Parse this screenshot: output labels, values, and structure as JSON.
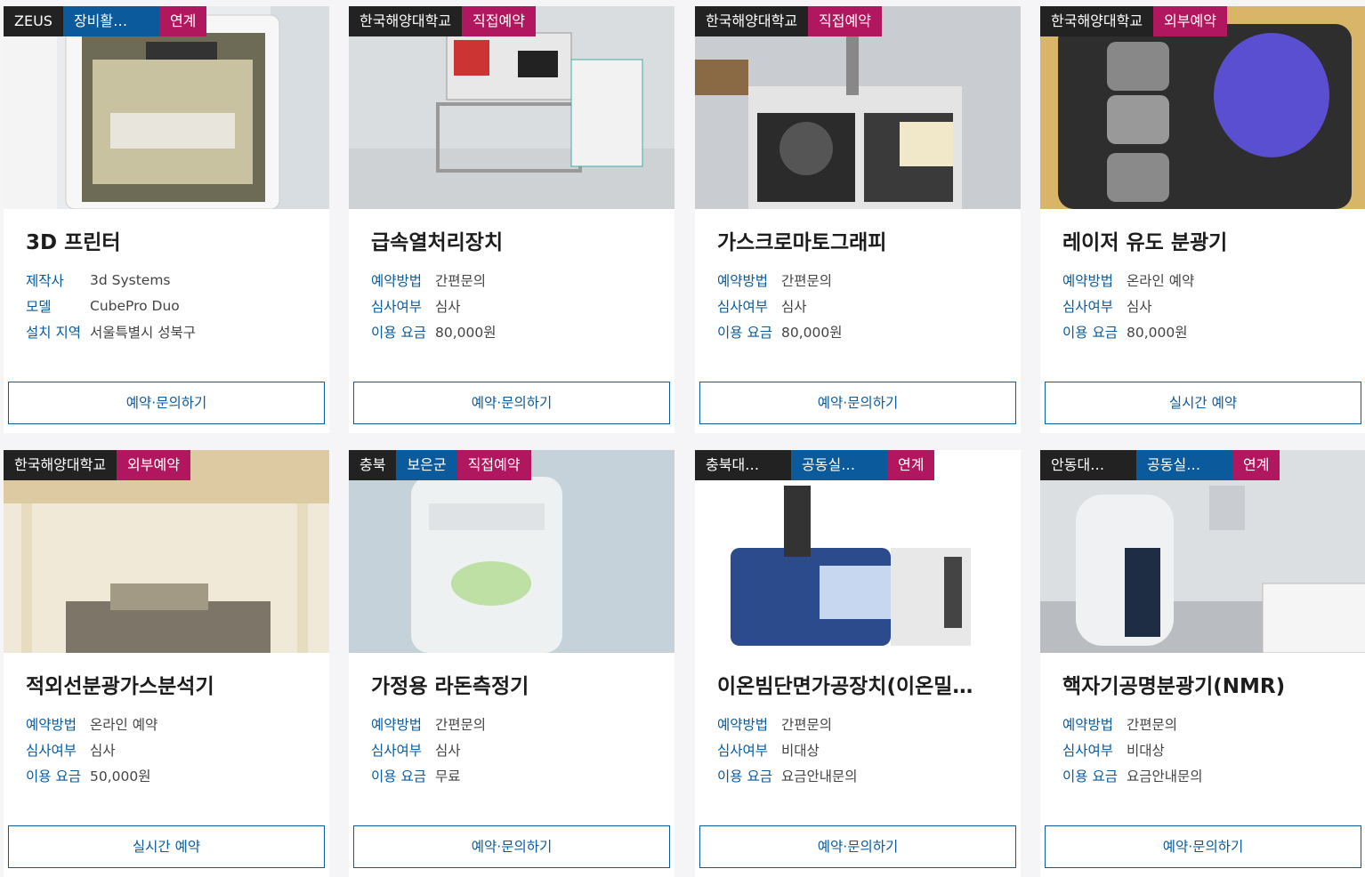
{
  "cards": [
    {
      "tags": [
        "ZEUS",
        "장비활…",
        "연계"
      ],
      "title": "3D 프린터",
      "rows": [
        {
          "k": "제작사",
          "v": "3d Systems"
        },
        {
          "k": "모델",
          "v": "CubePro Duo"
        },
        {
          "k": "설치 지역",
          "v": "서울특별시 성북구"
        }
      ],
      "button": "예약·문의하기"
    },
    {
      "tags": [
        "한국해양대학교",
        "직접예약"
      ],
      "title": "급속열처리장치",
      "rows": [
        {
          "k": "예약방법",
          "v": "간편문의"
        },
        {
          "k": "심사여부",
          "v": "심사"
        },
        {
          "k": "이용 요금",
          "v": "80,000원"
        }
      ],
      "button": "예약·문의하기"
    },
    {
      "tags": [
        "한국해양대학교",
        "직접예약"
      ],
      "title": "가스크로마토그래피",
      "rows": [
        {
          "k": "예약방법",
          "v": "간편문의"
        },
        {
          "k": "심사여부",
          "v": "심사"
        },
        {
          "k": "이용 요금",
          "v": "80,000원"
        }
      ],
      "button": "예약·문의하기"
    },
    {
      "tags": [
        "한국해양대학교",
        "외부예약"
      ],
      "title": "레이저 유도 분광기",
      "rows": [
        {
          "k": "예약방법",
          "v": "온라인 예약"
        },
        {
          "k": "심사여부",
          "v": "심사"
        },
        {
          "k": "이용 요금",
          "v": "80,000원"
        }
      ],
      "button": "실시간 예약"
    },
    {
      "tags": [
        "한국해양대학교",
        "외부예약"
      ],
      "title": "적외선분광가스분석기",
      "rows": [
        {
          "k": "예약방법",
          "v": "온라인 예약"
        },
        {
          "k": "심사여부",
          "v": "심사"
        },
        {
          "k": "이용 요금",
          "v": "50,000원"
        }
      ],
      "button": "실시간 예약"
    },
    {
      "tags": [
        "충북",
        "보은군",
        "직접예약"
      ],
      "title": "가정용 라돈측정기",
      "rows": [
        {
          "k": "예약방법",
          "v": "간편문의"
        },
        {
          "k": "심사여부",
          "v": "심사"
        },
        {
          "k": "이용 요금",
          "v": "무료"
        }
      ],
      "button": "예약·문의하기"
    },
    {
      "tags": [
        "충북대…",
        "공동실…",
        "연계"
      ],
      "title": "이온빔단면가공장치(이온밀…",
      "rows": [
        {
          "k": "예약방법",
          "v": "간편문의"
        },
        {
          "k": "심사여부",
          "v": "비대상"
        },
        {
          "k": "이용 요금",
          "v": "요금안내문의"
        }
      ],
      "button": "예약·문의하기"
    },
    {
      "tags": [
        "안동대…",
        "공동실…",
        "연계"
      ],
      "title": "핵자기공명분광기(NMR)",
      "rows": [
        {
          "k": "예약방법",
          "v": "간편문의"
        },
        {
          "k": "심사여부",
          "v": "비대상"
        },
        {
          "k": "이용 요금",
          "v": "요금안내문의"
        }
      ],
      "button": "예약·문의하기"
    }
  ]
}
